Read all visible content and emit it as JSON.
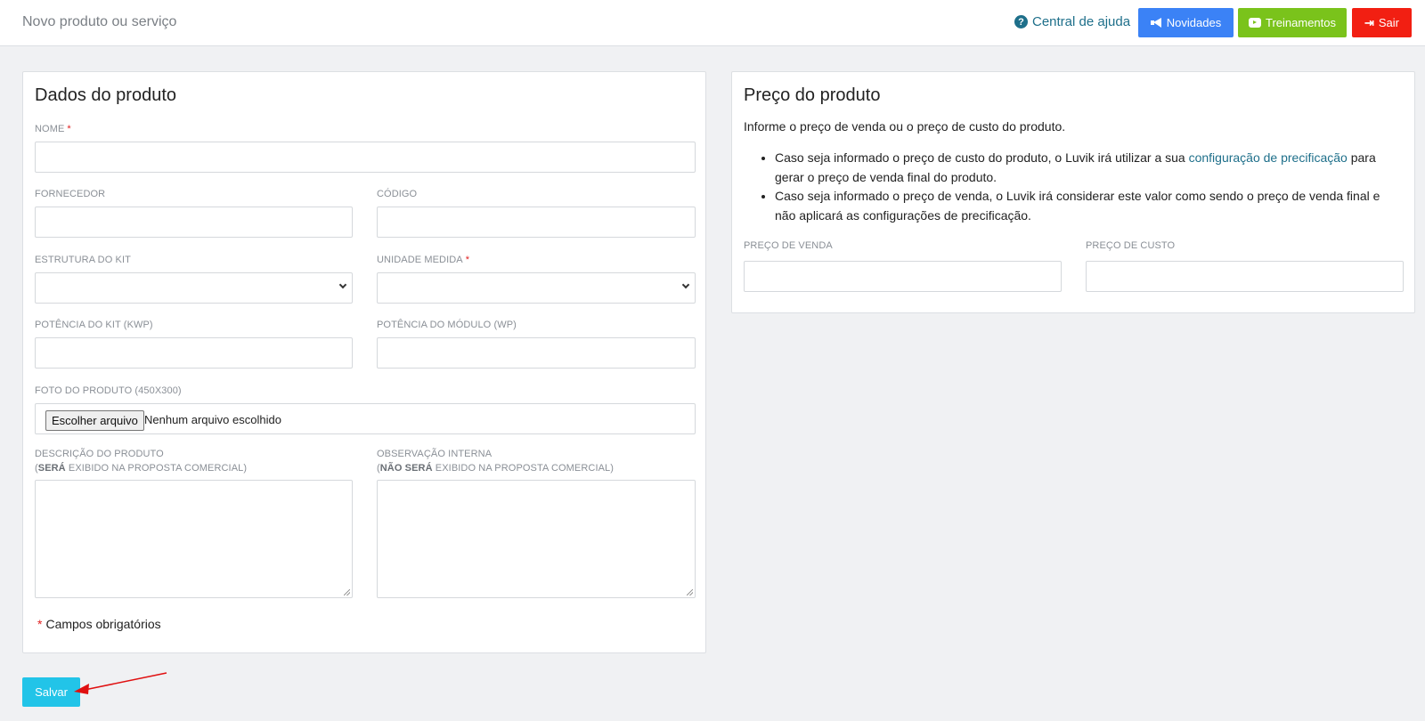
{
  "header": {
    "title": "Novo produto ou serviço",
    "help_label": "Central de ajuda",
    "buttons": {
      "novidades": "Novidades",
      "treinamentos": "Treinamentos",
      "sair": "Sair"
    },
    "colors": {
      "novidades": "#3b82f6",
      "treinamentos": "#7ac31b",
      "sair": "#f21f12"
    }
  },
  "product_card": {
    "title": "Dados do produto",
    "fields": {
      "nome": {
        "label": "NOME",
        "required_mark": "*",
        "value": ""
      },
      "fornecedor": {
        "label": "FORNECEDOR",
        "value": ""
      },
      "codigo": {
        "label": "CÓDIGO",
        "value": ""
      },
      "estrutura_kit": {
        "label": "ESTRUTURA DO KIT",
        "value": ""
      },
      "unidade_medida": {
        "label": "UNIDADE MEDIDA",
        "required_mark": "*",
        "value": ""
      },
      "potencia_kit": {
        "label": "POTÊNCIA DO KIT (KWP)",
        "value": ""
      },
      "potencia_modulo": {
        "label": "POTÊNCIA DO MÓDULO (WP)",
        "value": ""
      },
      "foto": {
        "label": "FOTO DO PRODUTO (450X300)",
        "button_label": "Escolher arquivo",
        "status": "Nenhum arquivo escolhido"
      },
      "descricao": {
        "label": "DESCRIÇÃO DO PRODUTO",
        "sub_open": "(",
        "sub_bold": "SERÁ",
        "sub_rest": " EXIBIDO NA PROPOSTA COMERCIAL)",
        "value": ""
      },
      "observacao": {
        "label": "OBSERVAÇÃO INTERNA",
        "sub_open": "(",
        "sub_bold": "NÃO SERÁ",
        "sub_rest": " EXIBIDO NA PROPOSTA COMERCIAL)",
        "value": ""
      }
    },
    "required_note": {
      "star": "*",
      "text": "Campos obrigatórios"
    }
  },
  "price_card": {
    "title": "Preço do produto",
    "intro": "Informe o preço de venda ou o preço de custo do produto.",
    "bullets": {
      "b1_before": "Caso seja informado o preço de custo do produto, o Luvik irá utilizar a sua ",
      "b1_link": "configuração de precificação",
      "b1_after": " para gerar o preço de venda final do produto.",
      "b2": "Caso seja informado o preço de venda, o Luvik irá considerar este valor como sendo o preço de venda final e não aplicará as configurações de precificação."
    },
    "fields": {
      "preco_venda": {
        "label": "PREÇO DE VENDA",
        "value": ""
      },
      "preco_custo": {
        "label": "PREÇO DE CUSTO",
        "value": ""
      }
    }
  },
  "actions": {
    "save_label": "Salvar",
    "save_color": "#22c4e8"
  }
}
